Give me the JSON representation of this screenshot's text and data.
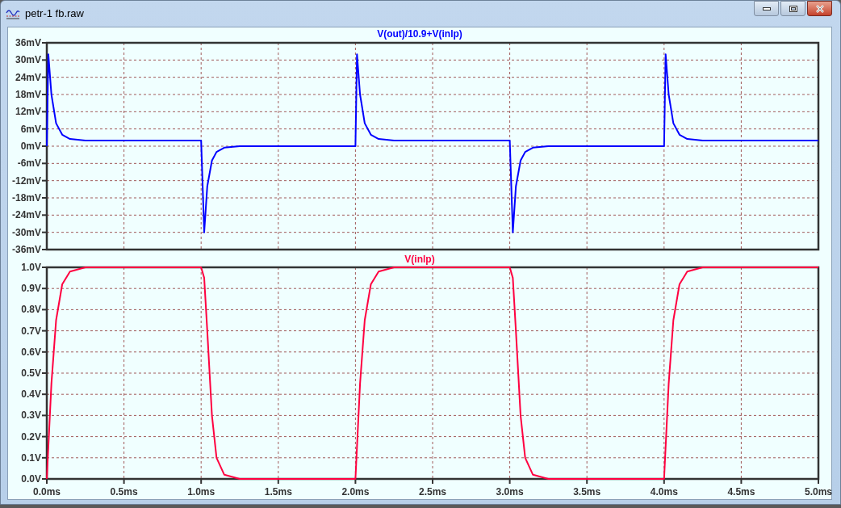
{
  "window": {
    "title": "petr-1 fb.raw"
  },
  "panes": [
    {
      "chart_data": {
        "type": "line",
        "grid": true,
        "ylim": [
          -36,
          36
        ],
        "xlim": [
          0,
          5
        ],
        "yticks": [
          {
            "value": 36,
            "label": "36mV"
          },
          {
            "value": 30,
            "label": "30mV"
          },
          {
            "value": 24,
            "label": "24mV"
          },
          {
            "value": 18,
            "label": "18mV"
          },
          {
            "value": 12,
            "label": "12mV"
          },
          {
            "value": 6,
            "label": "6mV"
          },
          {
            "value": 0,
            "label": "0mV"
          },
          {
            "value": -6,
            "label": "-6mV"
          },
          {
            "value": -12,
            "label": "-12mV"
          },
          {
            "value": -18,
            "label": "-18mV"
          },
          {
            "value": -24,
            "label": "-24mV"
          },
          {
            "value": -30,
            "label": "-30mV"
          },
          {
            "value": -36,
            "label": "-36mV"
          }
        ],
        "x": [
          0,
          0.01,
          0.03,
          0.06,
          0.1,
          0.15,
          0.25,
          1.0,
          1.02,
          1.04,
          1.07,
          1.1,
          1.15,
          1.25,
          2.0,
          2.01,
          2.03,
          2.06,
          2.1,
          2.15,
          2.25,
          3.0,
          3.02,
          3.04,
          3.07,
          3.1,
          3.15,
          3.25,
          4.0,
          4.01,
          4.03,
          4.06,
          4.1,
          4.15,
          4.25,
          5.0
        ],
        "series": [
          {
            "name": "V(out)/10.9+V(inlp)",
            "color": "#0000ff",
            "values": [
              0,
              32,
              18,
              8,
              4,
              2.5,
              2,
              2,
              -30,
              -14,
              -5,
              -2,
              -0.5,
              0,
              0,
              32,
              18,
              8,
              4,
              2.5,
              2,
              2,
              -30,
              -14,
              -5,
              -2,
              -0.5,
              0,
              0,
              32,
              18,
              8,
              4,
              2.5,
              2,
              2
            ]
          }
        ]
      }
    },
    {
      "chart_data": {
        "type": "line",
        "grid": true,
        "ylim": [
          0,
          1
        ],
        "xlim": [
          0,
          5
        ],
        "yticks": [
          {
            "value": 1,
            "label": "1.0V"
          },
          {
            "value": 0.9,
            "label": "0.9V"
          },
          {
            "value": 0.8,
            "label": "0.8V"
          },
          {
            "value": 0.7,
            "label": "0.7V"
          },
          {
            "value": 0.6,
            "label": "0.6V"
          },
          {
            "value": 0.5,
            "label": "0.5V"
          },
          {
            "value": 0.4,
            "label": "0.4V"
          },
          {
            "value": 0.3,
            "label": "0.3V"
          },
          {
            "value": 0.2,
            "label": "0.2V"
          },
          {
            "value": 0.1,
            "label": "0.1V"
          },
          {
            "value": 0,
            "label": "0.0V"
          }
        ],
        "xticks": [
          {
            "value": 0,
            "label": "0.0ms"
          },
          {
            "value": 0.5,
            "label": "0.5ms"
          },
          {
            "value": 1,
            "label": "1.0ms"
          },
          {
            "value": 1.5,
            "label": "1.5ms"
          },
          {
            "value": 2,
            "label": "2.0ms"
          },
          {
            "value": 2.5,
            "label": "2.5ms"
          },
          {
            "value": 3,
            "label": "3.0ms"
          },
          {
            "value": 3.5,
            "label": "3.5ms"
          },
          {
            "value": 4,
            "label": "4.0ms"
          },
          {
            "value": 4.5,
            "label": "4.5ms"
          },
          {
            "value": 5,
            "label": "5.0ms"
          }
        ],
        "x": [
          0,
          0.01,
          0.03,
          0.06,
          0.1,
          0.15,
          0.25,
          1.0,
          1.02,
          1.04,
          1.07,
          1.1,
          1.15,
          1.25,
          2.0,
          2.01,
          2.03,
          2.06,
          2.1,
          2.15,
          2.25,
          3.0,
          3.02,
          3.04,
          3.07,
          3.1,
          3.15,
          3.25,
          4.0,
          4.01,
          4.03,
          4.06,
          4.1,
          4.15,
          4.25,
          5.0
        ],
        "series": [
          {
            "name": "V(inlp)",
            "color": "#ff0040",
            "values": [
              0,
              0.15,
              0.45,
              0.75,
              0.92,
              0.98,
              1,
              1,
              0.95,
              0.7,
              0.3,
              0.1,
              0.02,
              0,
              0,
              0.15,
              0.45,
              0.75,
              0.92,
              0.98,
              1,
              1,
              0.95,
              0.7,
              0.3,
              0.1,
              0.02,
              0,
              0,
              0.15,
              0.45,
              0.75,
              0.92,
              0.98,
              1,
              1
            ]
          }
        ]
      }
    }
  ]
}
